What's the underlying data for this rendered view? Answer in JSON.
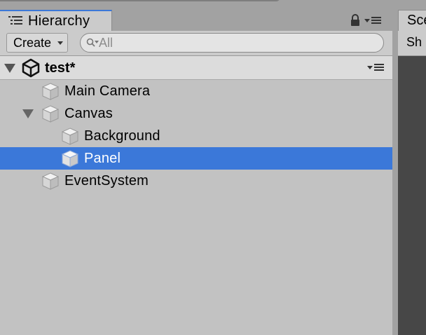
{
  "hierarchy": {
    "tab_title": "Hierarchy",
    "create_label": "Create",
    "search_placeholder": "All",
    "scene_name": "test*",
    "items": [
      {
        "name": "Main Camera",
        "depth": 1,
        "expanded": null,
        "selected": false
      },
      {
        "name": "Canvas",
        "depth": 1,
        "expanded": true,
        "selected": false
      },
      {
        "name": "Background",
        "depth": 2,
        "expanded": null,
        "selected": false
      },
      {
        "name": "Panel",
        "depth": 2,
        "expanded": null,
        "selected": true
      },
      {
        "name": "EventSystem",
        "depth": 1,
        "expanded": null,
        "selected": false
      }
    ]
  },
  "scene": {
    "tab_title": "Sce",
    "toolbar_label": "Sh"
  },
  "colors": {
    "selection": "#3b78d9",
    "panel_bg": "#c2c2c2",
    "scene_bg": "#474747"
  },
  "icons": [
    "hierarchy-icon",
    "lock-icon",
    "panel-menu-icon",
    "search-icon",
    "unity-logo-icon",
    "gameobject-cube-icon",
    "foldout-arrow-icon"
  ]
}
